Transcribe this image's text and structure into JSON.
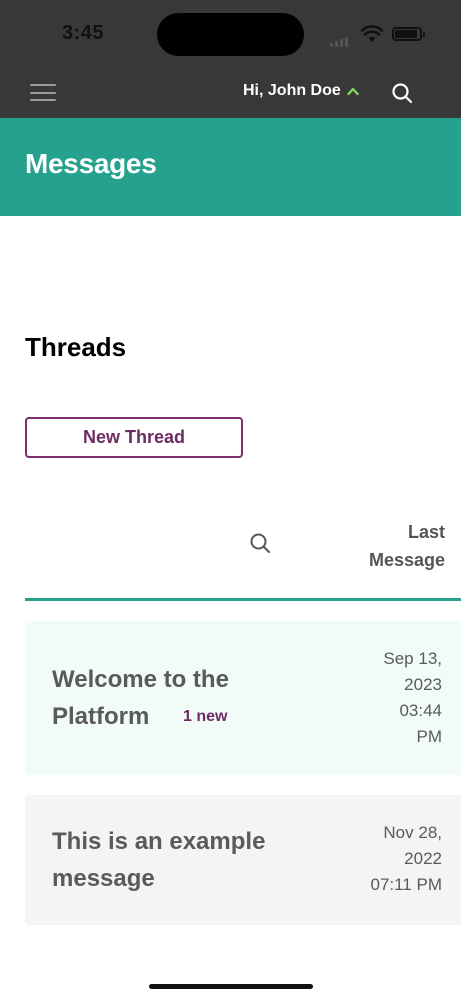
{
  "status_bar": {
    "time": "3:45"
  },
  "header": {
    "greeting": "Hi, John Doe"
  },
  "banner": {
    "title": "Messages"
  },
  "section": {
    "title": "Threads",
    "new_thread_label": "New Thread"
  },
  "table": {
    "last_message_header_line1": "Last",
    "last_message_header_line2": "Message"
  },
  "threads": [
    {
      "subject": "Welcome to the Platform",
      "badge": "1 new",
      "date_line1": "Sep 13,",
      "date_line2": "2023",
      "date_line3": "03:44",
      "date_line4": "PM"
    },
    {
      "subject": "This is an example message",
      "date_line1": "Nov 28,",
      "date_line2": "2022",
      "date_line3": "07:11 PM"
    }
  ],
  "colors": {
    "header_bg": "#383838",
    "accent_teal": "#25a18e",
    "accent_purple": "#6d2a63",
    "caret_green": "#7ed957"
  }
}
